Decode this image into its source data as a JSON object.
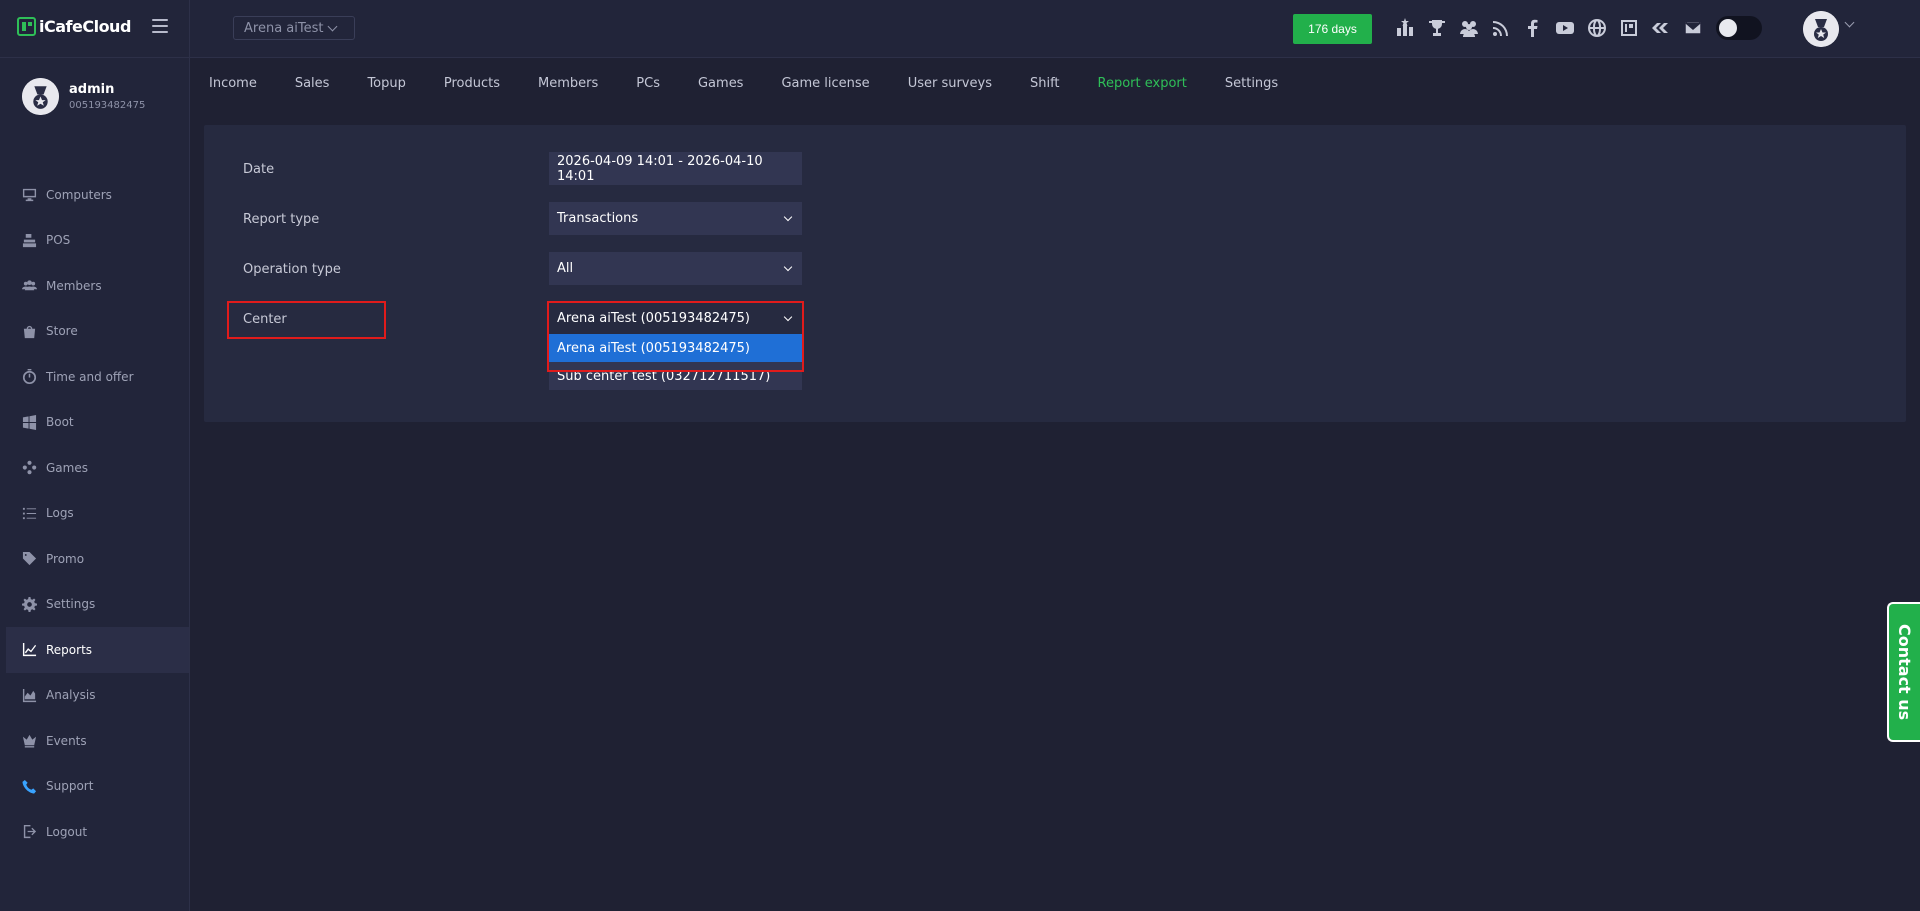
{
  "app": {
    "logo_text": "iCafeCloud"
  },
  "header": {
    "center_select": "Arena aiTest",
    "days_badge": "176 days",
    "icons": [
      "leaderboard-icon",
      "trophy-icon",
      "users-icon",
      "rss-icon",
      "facebook-icon",
      "youtube-icon",
      "globe-icon",
      "icafe-icon",
      "ggrock-icon",
      "mail-icon"
    ]
  },
  "user": {
    "name": "admin",
    "id": "005193482475"
  },
  "sidebar": {
    "items": [
      {
        "label": "Computers",
        "icon": "monitor-icon"
      },
      {
        "label": "POS",
        "icon": "pos-icon"
      },
      {
        "label": "Members",
        "icon": "members-icon"
      },
      {
        "label": "Store",
        "icon": "bag-icon"
      },
      {
        "label": "Time and offer",
        "icon": "stopwatch-icon"
      },
      {
        "label": "Boot",
        "icon": "windows-icon"
      },
      {
        "label": "Games",
        "icon": "gamepad-icon"
      },
      {
        "label": "Logs",
        "icon": "list-icon"
      },
      {
        "label": "Promo",
        "icon": "tag-icon"
      },
      {
        "label": "Settings",
        "icon": "gear-icon"
      },
      {
        "label": "Reports",
        "icon": "chart-line-icon",
        "active": true
      },
      {
        "label": "Analysis",
        "icon": "chart-area-icon"
      },
      {
        "label": "Events",
        "icon": "crown-icon"
      },
      {
        "label": "Support",
        "icon": "phone-icon"
      },
      {
        "label": "Logout",
        "icon": "logout-icon"
      }
    ]
  },
  "tabs": [
    "Income",
    "Sales",
    "Topup",
    "Products",
    "Members",
    "PCs",
    "Games",
    "Game license",
    "User surveys",
    "Shift",
    "Report export",
    "Settings"
  ],
  "active_tab": "Report export",
  "form": {
    "date_label": "Date",
    "date_value": "2026-04-09 14:01 - 2026-04-10 14:01",
    "report_type_label": "Report type",
    "report_type_value": "Transactions",
    "operation_type_label": "Operation type",
    "operation_type_value": "All",
    "center_label": "Center",
    "center_value": "Arena aiTest (005193482475)",
    "center_options": [
      "Arena aiTest (005193482475)",
      "Sub center test (032712711517)"
    ]
  },
  "contact_label": "Contact us",
  "colors": {
    "accent_green": "#22b04b",
    "highlight_red": "#e01b1b",
    "selected_blue": "#1f6fd6"
  }
}
